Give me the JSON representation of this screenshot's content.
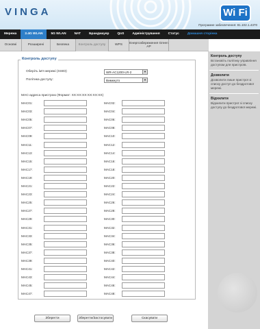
{
  "header": {
    "logo": "VINGA",
    "badge": "Wi Fi",
    "firmware": "Програмне забезпечення: 81.102.1.4370"
  },
  "nav": {
    "items": [
      "Мережа",
      "2.4G WLAN",
      "5G WLAN",
      "NAT",
      "Брандмауер",
      "QoS",
      "Адміністрування",
      "Статус",
      "Домашня сторінка"
    ],
    "active_index": 1
  },
  "subnav": {
    "items": [
      "Основні",
      "Розширені",
      "Безпека",
      "Контроль доступу",
      "WPS",
      "Енергозбереження Green AP"
    ],
    "active_index": 3
  },
  "form": {
    "legend": "Контроль доступу",
    "ssid_label": "Оберіть ім'я мережі (SSID):",
    "ssid_value": "WR-AC1200-LR-2",
    "policy_label": "Політика доступу:",
    "policy_value": "Вимкнуто",
    "mac_format": "MAC-адреса пристрою (Формат: XX:XX:XX:XX:XX:XX)",
    "mac_labels": [
      "MAC01:",
      "MAC02:",
      "MAC03:",
      "MAC04:",
      "MAC05:",
      "MAC06:",
      "MAC07:",
      "MAC08:",
      "MAC09:",
      "MAC10:",
      "MAC11:",
      "MAC12:",
      "MAC13:",
      "MAC14:",
      "MAC15:",
      "MAC16:",
      "MAC17:",
      "MAC18:",
      "MAC19:",
      "MAC20:",
      "MAC21:",
      "MAC22:",
      "MAC23:",
      "MAC24:",
      "MAC25:",
      "MAC26:",
      "MAC27:",
      "MAC28:",
      "MAC29:",
      "MAC30:",
      "MAC31:",
      "MAC32:",
      "MAC33:",
      "MAC34:",
      "MAC35:",
      "MAC36:",
      "MAC37:",
      "MAC38:",
      "MAC39:",
      "MAC40:",
      "MAC41:",
      "MAC42:",
      "MAC43:",
      "MAC44:",
      "MAC45:",
      "MAC46:",
      "MAC47:",
      "MAC48:"
    ]
  },
  "buttons": {
    "save": "Зберегти",
    "save_apply": "Зберегти/Застосувати",
    "cancel": "Скасувати"
  },
  "help": [
    {
      "title": "Контроль доступу",
      "text": "Встановіть політику управління доступом для пристроїв."
    },
    {
      "title": "Дозволити",
      "text": "Дозволити лише пристрої зі списку доступ до бездротової мережі."
    },
    {
      "title": "Відхилити",
      "text": "Відхилити пристрої зі списку доступу до бездротової мережі."
    }
  ],
  "colors": {
    "accent": "#2f7fc8",
    "nav_bg": "#1b1b1b",
    "help_bg": "#d4d4d4",
    "legend": "#2a5f97"
  },
  "icons": {
    "wifi_waves": "wifi-signal-icon",
    "dropdown": "chevron-down-icon"
  }
}
